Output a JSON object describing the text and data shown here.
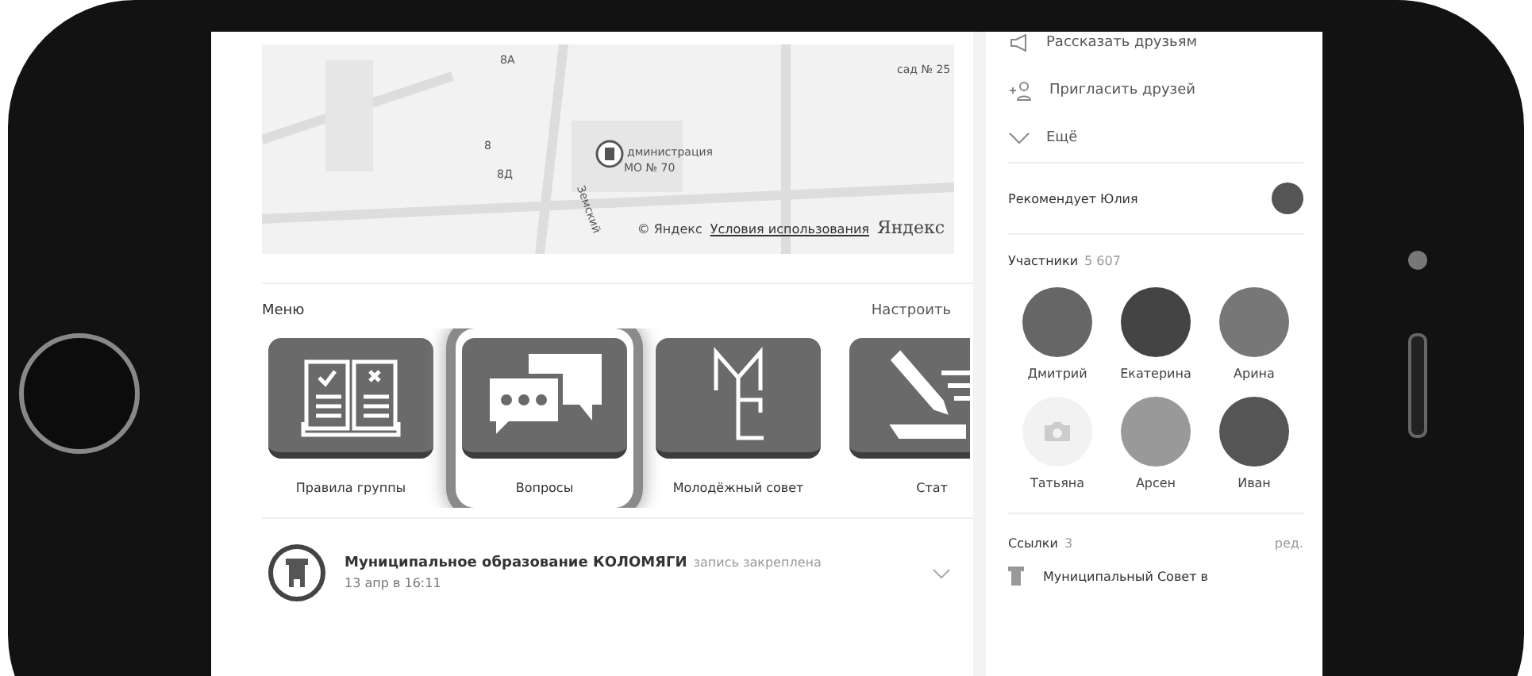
{
  "map": {
    "labels": [
      {
        "text": "8А"
      },
      {
        "text": "сад № 25"
      },
      {
        "text": "8"
      },
      {
        "text": "8Д"
      },
      {
        "text": "дминистрация"
      },
      {
        "text": "МО № 70"
      },
      {
        "text": "Земский"
      }
    ],
    "copyright": "© Яндекс",
    "terms_link": "Условия использования",
    "logo": "Яндекс"
  },
  "menu": {
    "title": "Меню",
    "action": "Настроить",
    "items": [
      {
        "label": "Правила группы",
        "kind": "rules",
        "selected": false
      },
      {
        "label": "Вопросы",
        "kind": "questions",
        "selected": true
      },
      {
        "label": "Молодёжный совет",
        "kind": "council",
        "selected": false
      },
      {
        "label": "Стат",
        "kind": "write",
        "selected": false
      }
    ]
  },
  "post": {
    "author": "Муниципальное образование КОЛОМЯГИ",
    "note": "запись закреплена",
    "time": "13 апр в 16:11"
  },
  "sidebar": {
    "actions": [
      {
        "label": "Рассказать друзьям",
        "kind": "share"
      },
      {
        "label": "Пригласить друзей",
        "kind": "invite"
      },
      {
        "label": "Ещё",
        "kind": "more"
      }
    ],
    "recommend": {
      "label": "Рекомендует Юлия"
    },
    "members": {
      "title": "Участники",
      "count": "5 607",
      "people": [
        {
          "name": "Дмитрий",
          "kind": "photo"
        },
        {
          "name": "Екатерина",
          "kind": "photo"
        },
        {
          "name": "Арина",
          "kind": "photo"
        },
        {
          "name": "Татьяна",
          "kind": "no_photo"
        },
        {
          "name": "Арсен",
          "kind": "photo"
        },
        {
          "name": "Иван",
          "kind": "photo"
        }
      ]
    },
    "links": {
      "title": "Ссылки",
      "count": "3",
      "action": "ред.",
      "items": [
        {
          "label": "Муниципальный Совет в"
        }
      ]
    }
  }
}
